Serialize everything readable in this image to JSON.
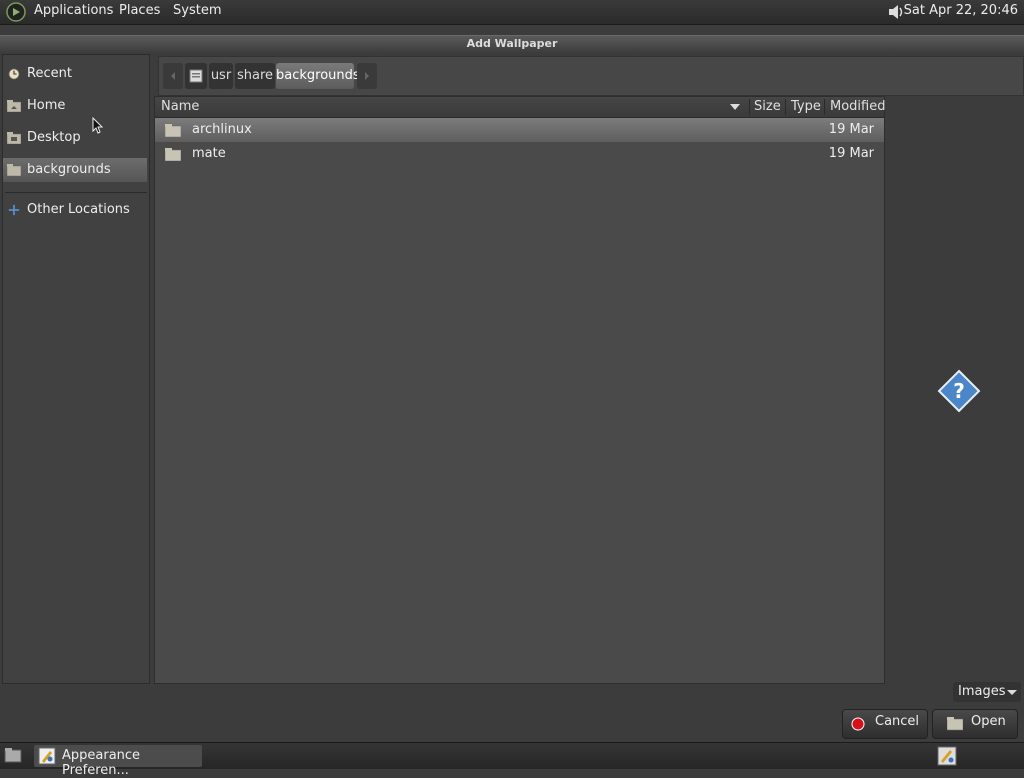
{
  "top_panel": {
    "menus": [
      "Applications",
      "Places",
      "System"
    ],
    "clock": "Sat Apr 22, 20:46"
  },
  "dialog": {
    "title": "Add Wallpaper"
  },
  "sidebar": {
    "items": [
      {
        "label": "Recent",
        "icon": "recent-icon"
      },
      {
        "label": "Home",
        "icon": "home-folder-icon"
      },
      {
        "label": "Desktop",
        "icon": "desktop-folder-icon"
      },
      {
        "label": "backgrounds",
        "icon": "folder-icon"
      },
      {
        "label": "Other Locations",
        "icon": "plus-icon"
      }
    ]
  },
  "pathbar": {
    "segments": [
      "usr",
      "share",
      "backgrounds"
    ]
  },
  "filelist": {
    "columns": {
      "name": "Name",
      "size": "Size",
      "type": "Type",
      "modified": "Modified"
    },
    "rows": [
      {
        "name": "archlinux",
        "modified": "19 Mar"
      },
      {
        "name": "mate",
        "modified": "19 Mar"
      }
    ]
  },
  "filter": {
    "selected": "Images"
  },
  "buttons": {
    "cancel": "Cancel",
    "open": "Open"
  },
  "taskbar": {
    "app_label": "Appearance Preferen..."
  }
}
